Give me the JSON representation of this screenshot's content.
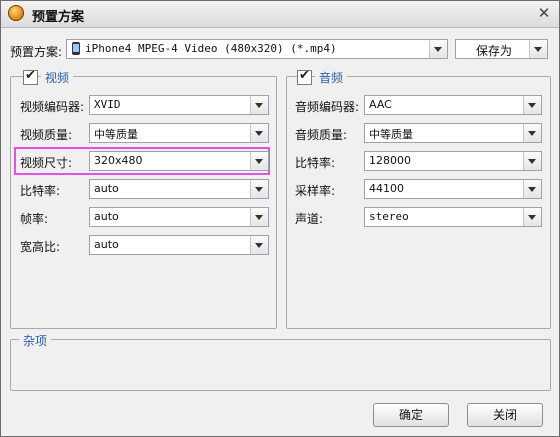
{
  "window": {
    "title": "预置方案",
    "close_glyph": "✕"
  },
  "preset": {
    "label": "预置方案:",
    "value": "iPhone4 MPEG-4 Video (480x320) (*.mp4)",
    "save_as_label": "保存为"
  },
  "video": {
    "legend": "视频",
    "codec": {
      "label": "视频编码器:",
      "value": "XVID"
    },
    "quality": {
      "label": "视频质量:",
      "value": "中等质量"
    },
    "size": {
      "label": "视频尺寸:",
      "value": "320x480"
    },
    "bitrate": {
      "label": "比特率:",
      "value": "auto"
    },
    "framerate": {
      "label": "帧率:",
      "value": "auto"
    },
    "aspect": {
      "label": "宽高比:",
      "value": "auto"
    }
  },
  "audio": {
    "legend": "音频",
    "codec": {
      "label": "音频编码器:",
      "value": "AAC"
    },
    "quality": {
      "label": "音频质量:",
      "value": "中等质量"
    },
    "bitrate": {
      "label": "比特率:",
      "value": "128000"
    },
    "samplerate": {
      "label": "采样率:",
      "value": "44100"
    },
    "channels": {
      "label": "声道:",
      "value": "stereo"
    }
  },
  "misc": {
    "legend": "杂项"
  },
  "footer": {
    "ok_label": "确定",
    "close_label": "关闭"
  },
  "checkmark": "✔",
  "highlight_color": "#e84ee8"
}
